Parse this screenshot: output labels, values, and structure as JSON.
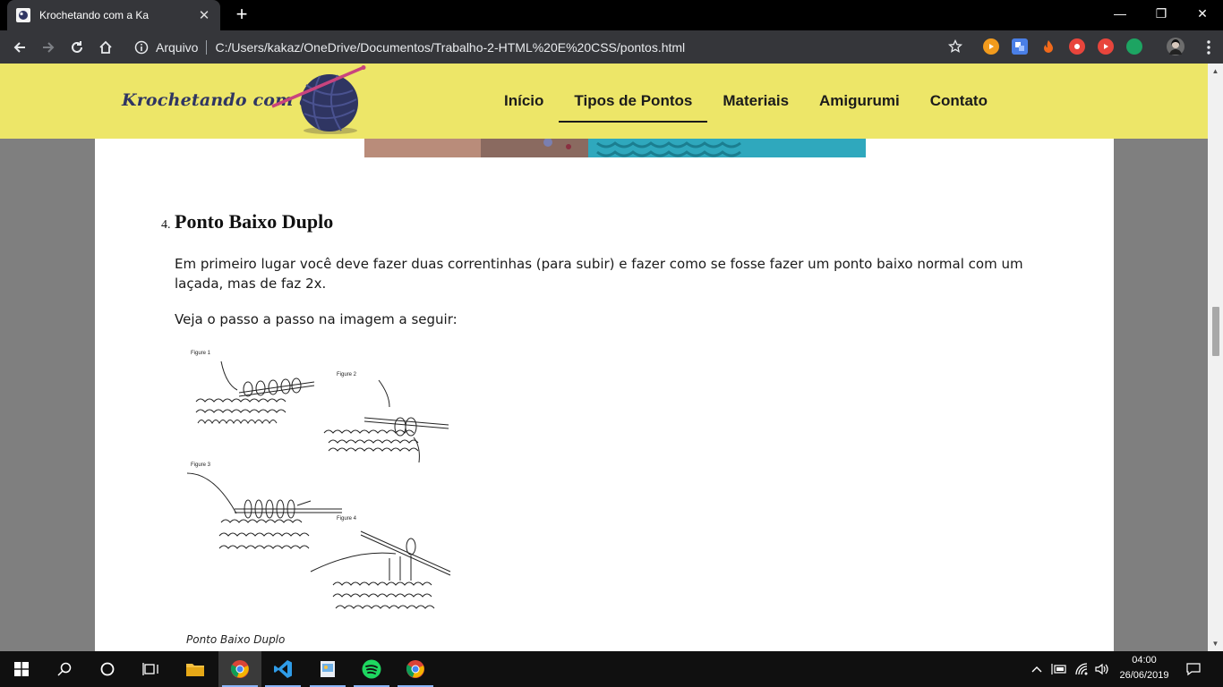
{
  "browser": {
    "tab_title": "Krochetando com a Ka",
    "close_glyph": "✕",
    "new_tab_glyph": "+",
    "window_controls": {
      "minimize": "—",
      "restore": "❐",
      "close": "✕"
    },
    "address": {
      "scheme_label": "Arquivo",
      "url": "C:/Users/kakaz/OneDrive/Documentos/Trabalho-2-HTML%20E%20CSS/pontos.html"
    },
    "extension_badge": "14",
    "colors": {
      "tabbar": "#000000",
      "toolbar": "#35363a",
      "text": "#e8eaed"
    }
  },
  "site": {
    "logo_text": "Krochetando com a Ka",
    "nav": [
      {
        "label": "Início"
      },
      {
        "label": "Tipos de Pontos"
      },
      {
        "label": "Materiais"
      },
      {
        "label": "Amigurumi"
      },
      {
        "label": "Contato"
      }
    ],
    "active_nav": "Tipos de Pontos",
    "colors": {
      "header": "#ede668",
      "logo": "#2f3562",
      "yarn": "#2f3562",
      "hook": "#c9447e"
    }
  },
  "article": {
    "item_number": "4.",
    "heading": "Ponto Baixo Duplo",
    "paragraph_1": "Em primeiro lugar você deve fazer duas correntinhas (para subir) e fazer como se fosse fazer um ponto baixo normal com um laçada, mas de faz 2x.",
    "paragraph_2": "Veja o passo a passo na imagem a seguir:",
    "figure_labels": [
      "Figure 1",
      "Figure 2",
      "Figure 3",
      "Figure 4"
    ],
    "caption": "Ponto Baixo Duplo"
  },
  "taskbar": {
    "time": "04:00",
    "date": "26/06/2019",
    "apps": [
      "start-icon",
      "search-icon",
      "cortana-icon",
      "task-view-icon",
      "file-explorer-icon",
      "chrome-icon",
      "vscode-icon",
      "paint-icon",
      "spotify-icon",
      "chrome-icon"
    ]
  }
}
